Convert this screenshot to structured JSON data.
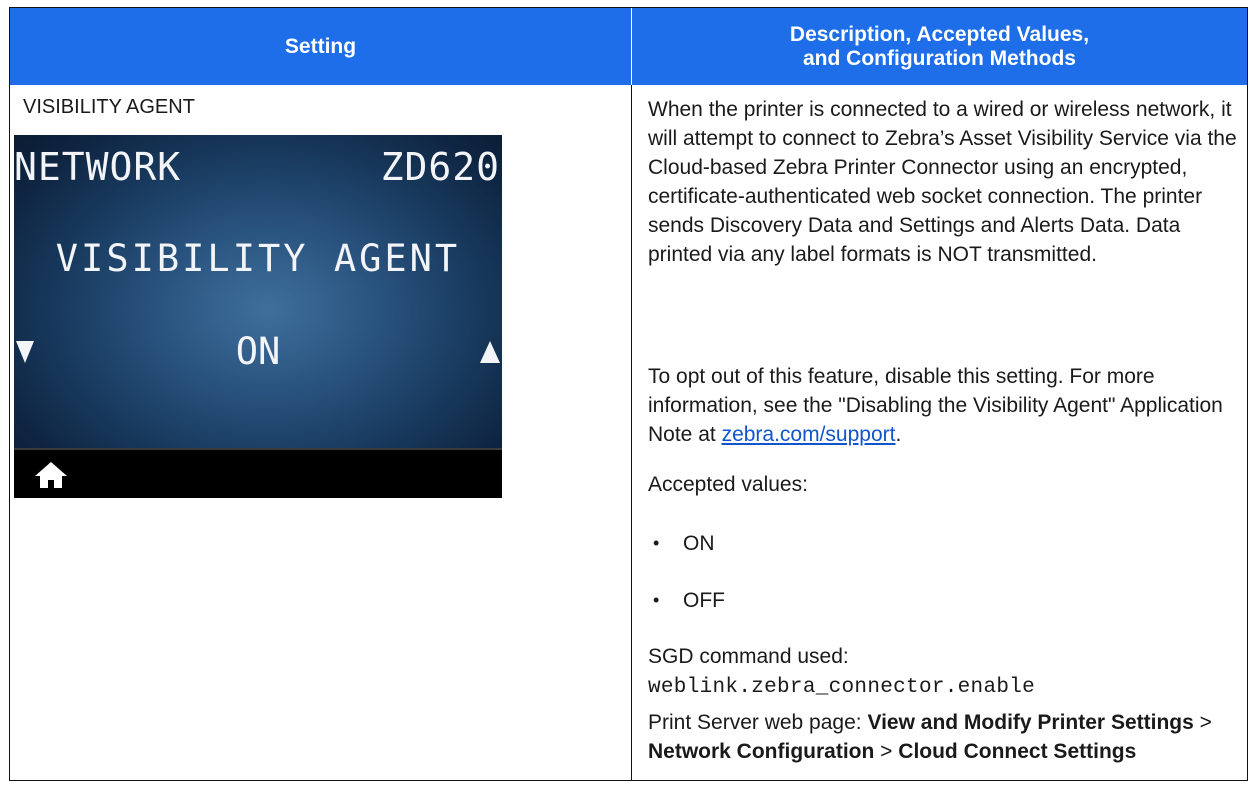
{
  "table": {
    "header": {
      "setting": "Setting",
      "description_line1": "Description, Accepted Values,",
      "description_line2": "and Configuration Methods"
    },
    "row": {
      "setting_name": "VISIBILITY AGENT",
      "lcd": {
        "menu": "NETWORK",
        "model": "ZD620",
        "title": "VISIBILITY AGENT",
        "value": "ON",
        "icons": [
          "arrow-down-icon",
          "arrow-up-icon",
          "home-icon"
        ],
        "colors": {
          "background": "#1b3f66",
          "footer": "#000000",
          "text": "#f2f4f8"
        }
      },
      "description": {
        "intro": "When the printer is connected to a wired or wireless network, it will attempt to connect to Zebra’s Asset Visibility Service via the Cloud-based Zebra Printer Connector using an encrypted, certificate-authenticated web socket connection. The printer sends Discovery Data and Settings and Alerts Data. Data printed via any label formats is NOT transmitted.",
        "opt_out_prefix": "To opt out of this feature, disable this setting. For more information, see the \"Disabling the Visibility Agent\" Application Note at",
        "opt_out_link": "zebra.com/support",
        "opt_out_suffix": ".",
        "accepted_label": "Accepted values:",
        "accepted_values": [
          "ON",
          "OFF"
        ],
        "sgd_label": "SGD command used:",
        "sgd_command": "weblink.zebra_connector.enable",
        "print_server_label": "Print Server web page:",
        "path_1": "View and Modify Printer Settings",
        "separator_1": ">",
        "path_2": "Network Configuration",
        "separator_2": ">",
        "path_3": "Cloud Connect Settings"
      }
    }
  },
  "colors": {
    "header_bg": "#1d6ee8",
    "header_text": "#ffffff",
    "link": "#1155cc",
    "border": "#111111"
  }
}
